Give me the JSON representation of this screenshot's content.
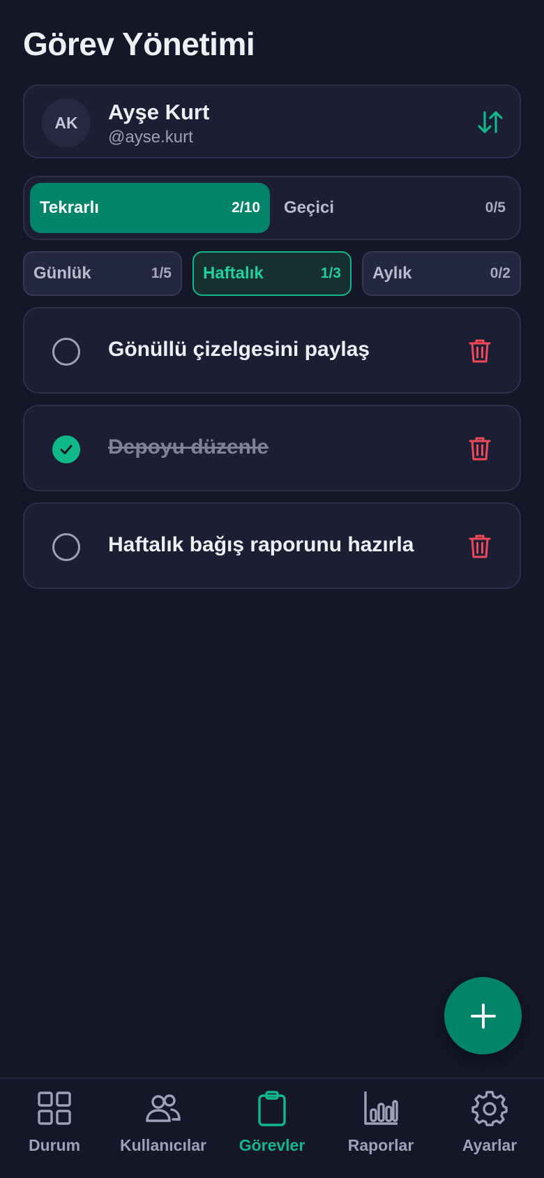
{
  "header": {
    "title": "Görev Yönetimi"
  },
  "user": {
    "initials": "AK",
    "name": "Ayşe Kurt",
    "handle": "@ayse.kurt",
    "action_icon": "swap-vertical-icon"
  },
  "task_types": [
    {
      "label": "Tekrarlı",
      "count": "2/10",
      "active": true
    },
    {
      "label": "Geçici",
      "count": "0/5",
      "active": false
    }
  ],
  "periods": [
    {
      "label": "Günlük",
      "count": "1/5",
      "active": false
    },
    {
      "label": "Haftalık",
      "count": "1/3",
      "active": true
    },
    {
      "label": "Aylık",
      "count": "0/2",
      "active": false
    }
  ],
  "tasks": [
    {
      "text": "Gönüllü çizelgesini paylaş",
      "done": false
    },
    {
      "text": "Depoyu düzenle",
      "done": true
    },
    {
      "text": "Haftalık bağış raporunu hazırla",
      "done": false
    }
  ],
  "fab": {
    "icon": "plus-icon"
  },
  "nav": [
    {
      "label": "Durum",
      "icon": "grid-icon",
      "active": false
    },
    {
      "label": "Kullanıcılar",
      "icon": "users-icon",
      "active": false
    },
    {
      "label": "Görevler",
      "icon": "clipboard-icon",
      "active": true
    },
    {
      "label": "Raporlar",
      "icon": "bar-chart-icon",
      "active": false
    },
    {
      "label": "Ayarlar",
      "icon": "gear-icon",
      "active": false
    }
  ],
  "colors": {
    "background": "#151728",
    "card": "#1c1e33",
    "accent": "#00856a",
    "accent_bright": "#10b98a",
    "danger": "#f04a5a",
    "muted": "#9ea1b6"
  }
}
